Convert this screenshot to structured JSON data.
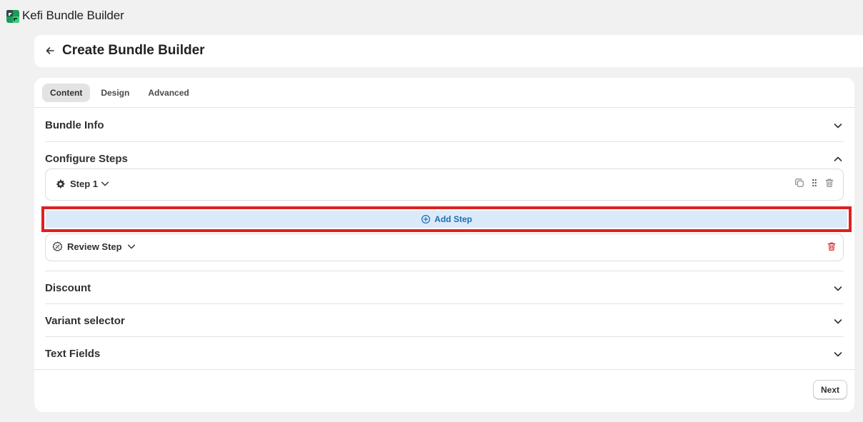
{
  "app": {
    "title": "Kefi Bundle Builder",
    "logo_icon": "kefi-logo-icon"
  },
  "header": {
    "title": "Create Bundle Builder",
    "back_icon": "arrow-left-icon"
  },
  "tabs": [
    {
      "label": "Content",
      "active": true
    },
    {
      "label": "Design",
      "active": false
    },
    {
      "label": "Advanced",
      "active": false
    }
  ],
  "sections": {
    "bundle_info": {
      "title": "Bundle Info",
      "expanded": false
    },
    "configure_steps": {
      "title": "Configure Steps",
      "expanded": true,
      "steps": [
        {
          "label": "Step 1",
          "icon": "gear-icon",
          "actions": [
            "duplicate-icon",
            "drag-handle-icon",
            "trash-icon"
          ]
        }
      ],
      "add_step_label": "Add Step",
      "review_step": {
        "label": "Review Step",
        "icon": "review-badge-icon",
        "delete_icon": "trash-icon"
      }
    },
    "discount": {
      "title": "Discount",
      "expanded": false
    },
    "variant_selector": {
      "title": "Variant selector",
      "expanded": false
    },
    "text_fields": {
      "title": "Text Fields",
      "expanded": false
    }
  },
  "footer": {
    "next_label": "Next"
  },
  "colors": {
    "page_bg": "#f1f1f1",
    "accent_blue": "#1a6fb3",
    "add_step_bg": "#dbeafb",
    "highlight_red": "#e02020",
    "delete_red": "#d72c2c"
  }
}
